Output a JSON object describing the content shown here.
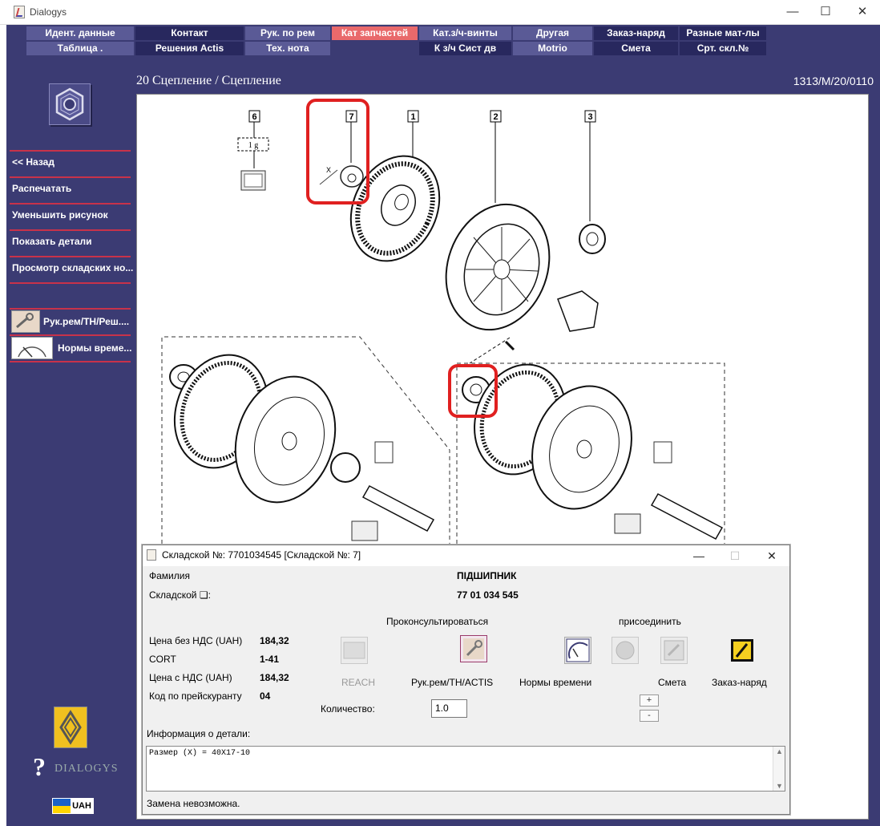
{
  "window": {
    "title": "Dialogys",
    "min": "—",
    "max": "☐",
    "close": "✕"
  },
  "tabs_row1": [
    "Идент. данные",
    "Контакт",
    "Рук. по рем",
    "Кат запчастей",
    "Кат.з/ч-винты",
    "Другая",
    "Заказ-наряд",
    "Разные мат-лы"
  ],
  "tabs_row2": [
    "Таблица .",
    "Решения Actis",
    "Тех. нота",
    "",
    "К з/ч Сист дв",
    "Motrio",
    "Смета",
    "Срт. скл.№"
  ],
  "sidebar": {
    "back": "<< Назад",
    "print": "Распечатать",
    "shrink": "Уменьшить рисунок",
    "show_details": "Показать детали",
    "view_stock": "Просмотр складских но...",
    "manual": "Рук.рем/ТН/Реш....",
    "time_norms": "Нормы време...",
    "brand": "DIALOGYS",
    "currency": "UAH"
  },
  "content": {
    "breadcrumb": "20 Сцепление / Сцепление",
    "code": "1313/M/20/0110"
  },
  "diagram": {
    "callouts": [
      "6",
      "7",
      "1",
      "2",
      "3"
    ],
    "grease_label": "1 g",
    "dim_label": "X"
  },
  "dialog": {
    "title": "Складской №: 7701034545 [Складской №: 7]",
    "family_label": "Фамилия",
    "family_value": "ПІДШИПНИК",
    "stock_label": "Складской ❏:",
    "stock_value": "77 01 034 545",
    "consult": "Проконсультироваться",
    "attach": "присоединить",
    "price_net_label": "Цена без НДС (UAH)",
    "price_net_value": "184,32",
    "cort_label": "CORT",
    "cort_value": "1-41",
    "price_vat_label": "Цена с НДС (UAH)",
    "price_vat_value": "184,32",
    "pricelist_label": "Код по прейскуранту",
    "pricelist_value": "04",
    "btn_reach": "REACH",
    "btn_manual": "Рук.рем/ТН/ACTIS",
    "btn_norms": "Нормы времени",
    "btn_estimate": "Смета",
    "btn_order": "Заказ-наряд",
    "qty_label": "Количество:",
    "qty_value": "1.0",
    "plus": "+",
    "minus": "-",
    "info_label": "Информация о детали:",
    "info_text": "Размер (X) = 40X17-10",
    "status": "Замена невозможна."
  },
  "colors": {
    "navy": "#3b3b73",
    "tab_light": "#5a5a96",
    "tab_dark": "#28285e",
    "tab_active": "#e9696b",
    "separator": "#c8324a",
    "callout": "#e02020"
  }
}
